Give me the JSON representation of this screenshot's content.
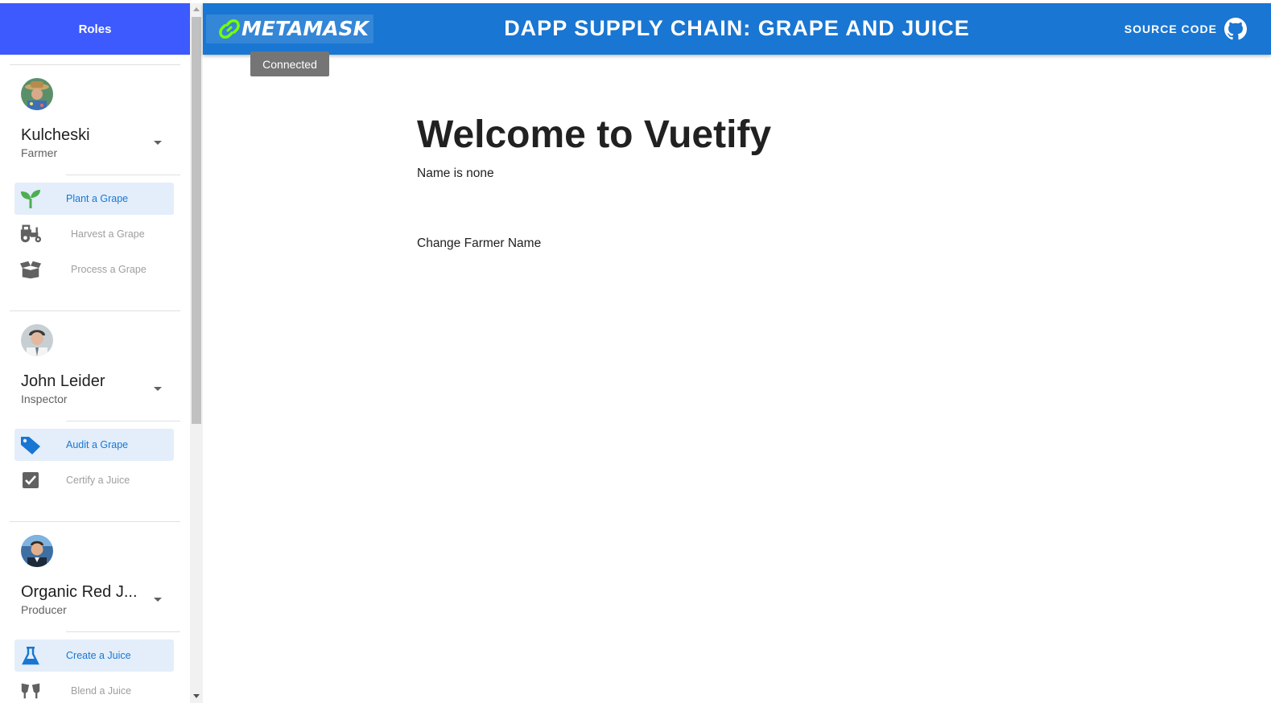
{
  "sidebar": {
    "header": "Roles",
    "roles": [
      {
        "name": "Kulcheski",
        "subtitle": "Farmer",
        "actions": [
          {
            "label": "Plant a Grape",
            "icon": "sprout-icon"
          },
          {
            "label": "Harvest a Grape",
            "icon": "tractor-icon"
          },
          {
            "label": "Process a Grape",
            "icon": "open-box-icon"
          }
        ]
      },
      {
        "name": "John Leider",
        "subtitle": "Inspector",
        "actions": [
          {
            "label": "Audit a Grape",
            "icon": "tag-icon"
          },
          {
            "label": "Certify a Juice",
            "icon": "checkbox-icon"
          }
        ]
      },
      {
        "name": "Organic Red J...",
        "subtitle": "Producer",
        "actions": [
          {
            "label": "Create a Juice",
            "icon": "flask-icon"
          },
          {
            "label": "Blend a Juice",
            "icon": "glasses-cheers-icon"
          }
        ]
      }
    ]
  },
  "topbar": {
    "metamask_label": "METAMASK",
    "title": "DAPP SUPPLY CHAIN: GRAPE AND JUICE",
    "source_code_label": "SOURCE CODE",
    "tooltip": "Connected"
  },
  "main": {
    "heading": "Welcome to Vuetify",
    "name_line": "Name is none",
    "change_button": "Change Farmer Name"
  },
  "colors": {
    "sidebar_header": "#3d5afe",
    "topbar": "#1976d2",
    "metamask_link": "#76ff03",
    "active_label": "#1976d2",
    "sprout": "#4caf50"
  }
}
